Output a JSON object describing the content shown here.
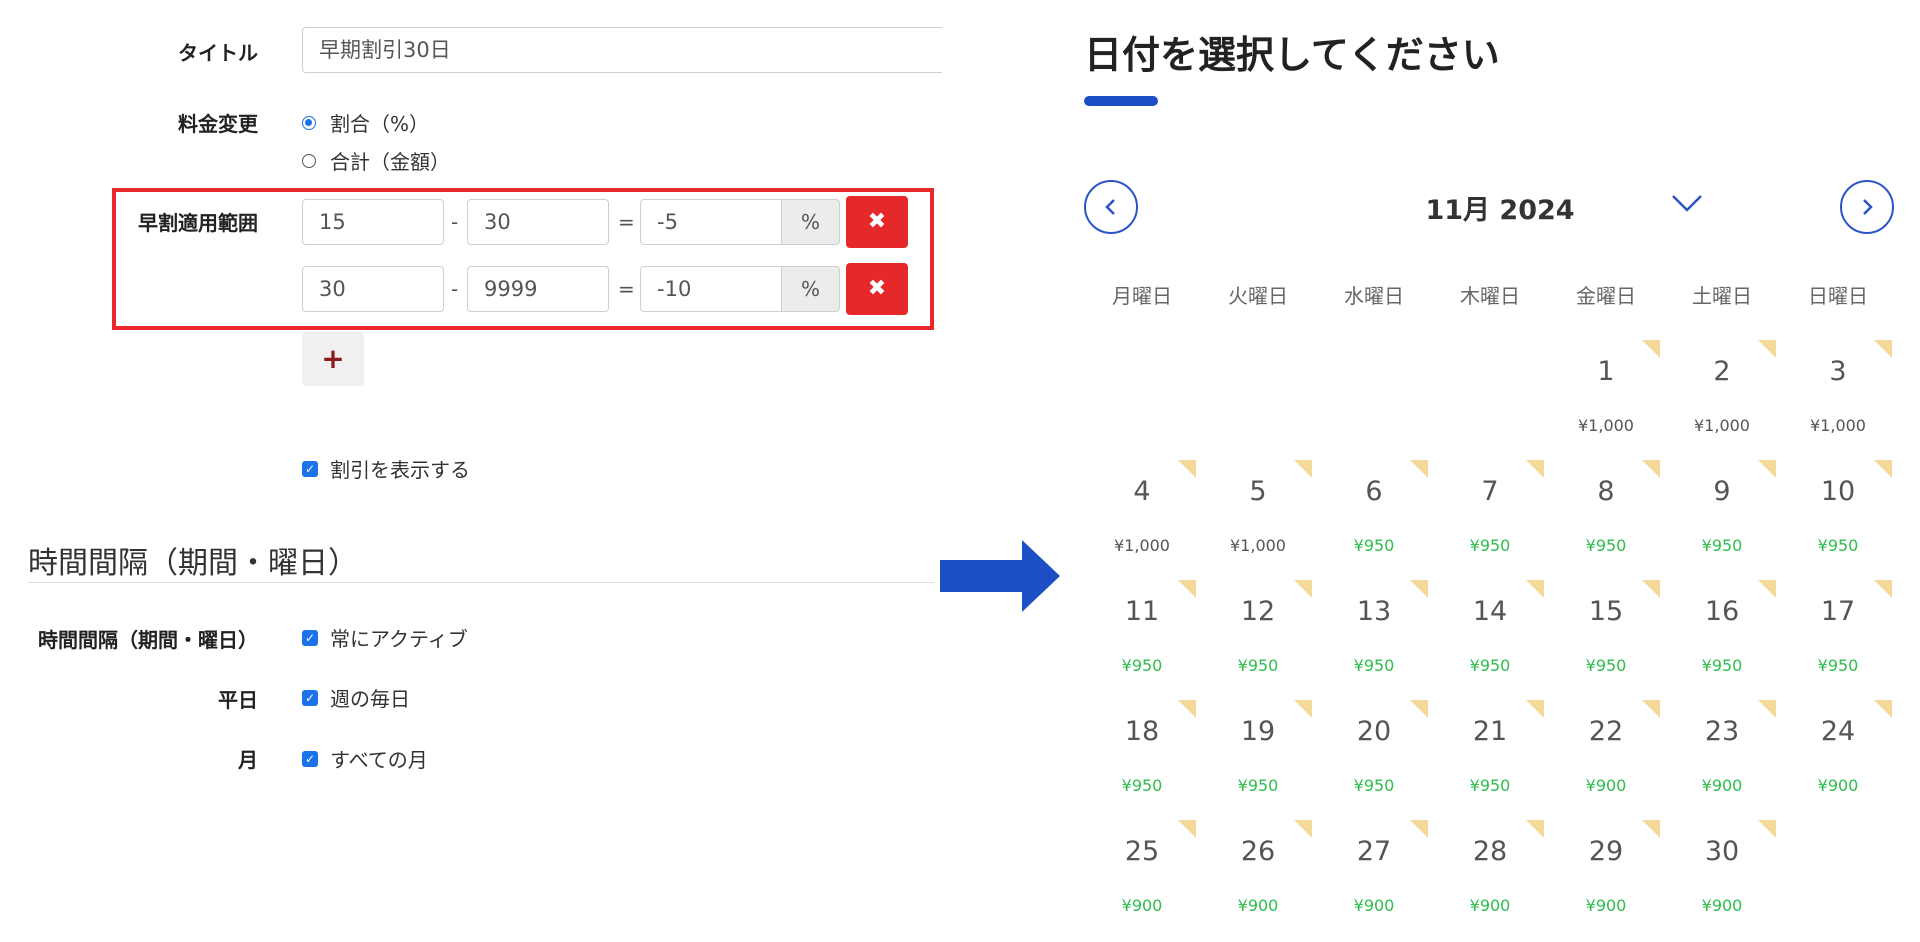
{
  "form": {
    "title_label": "タイトル",
    "title_value": "早期割引30日",
    "price_change_label": "料金変更",
    "price_change_options": [
      {
        "label": "割合（%）",
        "selected": true
      },
      {
        "label": "合計（金額）",
        "selected": false
      }
    ],
    "range_label": "早割適用範囲",
    "ranges": [
      {
        "from": "15",
        "to": "30",
        "value": "-5",
        "unit": "%"
      },
      {
        "from": "30",
        "to": "9999",
        "value": "-10",
        "unit": "%"
      }
    ],
    "dash": "-",
    "equals": "=",
    "delete_icon": "✖",
    "add_icon": "+",
    "show_discount_label": "割引を表示する",
    "section_title": "時間間隔（期間・曜日）",
    "interval_label": "時間間隔（期間・曜日）",
    "interval_value": "常にアクティブ",
    "weekday_label": "平日",
    "weekday_value": "週の毎日",
    "month_label": "月",
    "month_value": "すべての月"
  },
  "calendar": {
    "title": "日付を選択してください",
    "month_label": "11月 2024",
    "accent_color": "#1d4fc4",
    "weekdays": [
      "月曜日",
      "火曜日",
      "水曜日",
      "木曜日",
      "金曜日",
      "土曜日",
      "日曜日"
    ],
    "first_weekday_index": 4,
    "days": [
      {
        "day": "1",
        "price": "¥1,000",
        "discounted": false
      },
      {
        "day": "2",
        "price": "¥1,000",
        "discounted": false
      },
      {
        "day": "3",
        "price": "¥1,000",
        "discounted": false
      },
      {
        "day": "4",
        "price": "¥1,000",
        "discounted": false
      },
      {
        "day": "5",
        "price": "¥1,000",
        "discounted": false
      },
      {
        "day": "6",
        "price": "¥950",
        "discounted": true
      },
      {
        "day": "7",
        "price": "¥950",
        "discounted": true
      },
      {
        "day": "8",
        "price": "¥950",
        "discounted": true
      },
      {
        "day": "9",
        "price": "¥950",
        "discounted": true
      },
      {
        "day": "10",
        "price": "¥950",
        "discounted": true
      },
      {
        "day": "11",
        "price": "¥950",
        "discounted": true
      },
      {
        "day": "12",
        "price": "¥950",
        "discounted": true
      },
      {
        "day": "13",
        "price": "¥950",
        "discounted": true
      },
      {
        "day": "14",
        "price": "¥950",
        "discounted": true
      },
      {
        "day": "15",
        "price": "¥950",
        "discounted": true
      },
      {
        "day": "16",
        "price": "¥950",
        "discounted": true
      },
      {
        "day": "17",
        "price": "¥950",
        "discounted": true
      },
      {
        "day": "18",
        "price": "¥950",
        "discounted": true
      },
      {
        "day": "19",
        "price": "¥950",
        "discounted": true
      },
      {
        "day": "20",
        "price": "¥950",
        "discounted": true
      },
      {
        "day": "21",
        "price": "¥950",
        "discounted": true
      },
      {
        "day": "22",
        "price": "¥900",
        "discounted": true
      },
      {
        "day": "23",
        "price": "¥900",
        "discounted": true
      },
      {
        "day": "24",
        "price": "¥900",
        "discounted": true
      },
      {
        "day": "25",
        "price": "¥900",
        "discounted": true
      },
      {
        "day": "26",
        "price": "¥900",
        "discounted": true
      },
      {
        "day": "27",
        "price": "¥900",
        "discounted": true
      },
      {
        "day": "28",
        "price": "¥900",
        "discounted": true
      },
      {
        "day": "29",
        "price": "¥900",
        "discounted": true
      },
      {
        "day": "30",
        "price": "¥900",
        "discounted": true
      }
    ],
    "colors": {
      "regular_price": "#555555",
      "discount_price": "#2dbd4e",
      "flag": "#f5d998",
      "arrow": "#1d4fc4",
      "highlight_border": "#e8282b",
      "delete_button": "#e5282a"
    }
  }
}
